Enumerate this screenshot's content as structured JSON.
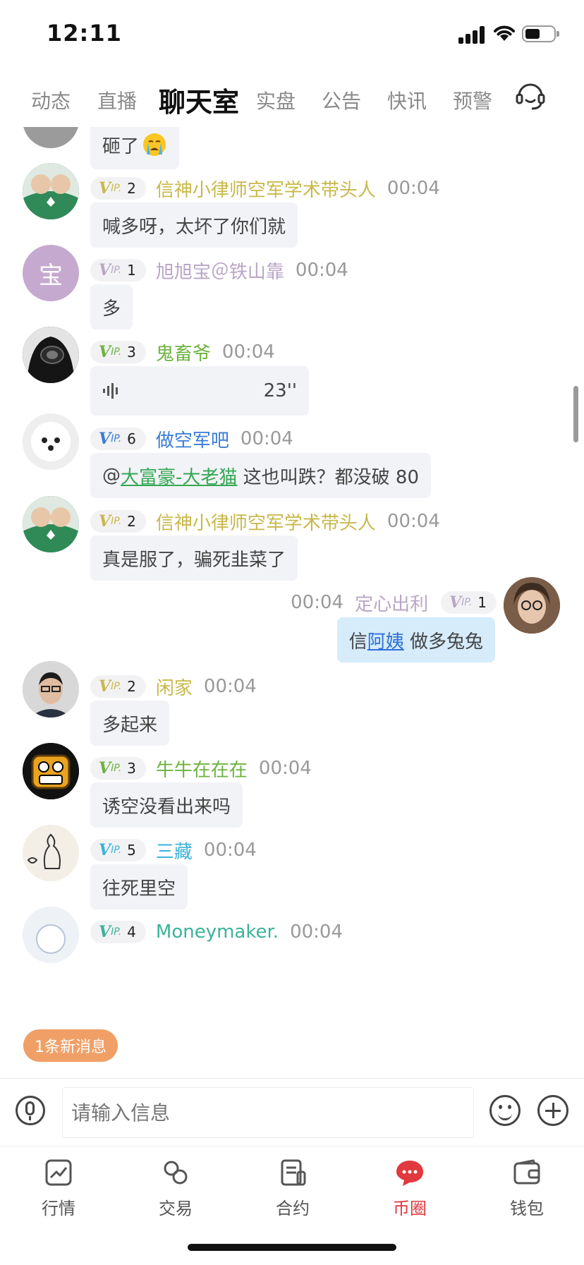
{
  "status_bar": {
    "time": "12:11"
  },
  "tabs": [
    {
      "label": "动态",
      "active": false
    },
    {
      "label": "直播",
      "active": false
    },
    {
      "label": "聊天室",
      "active": true
    },
    {
      "label": "实盘",
      "active": false
    },
    {
      "label": "公告",
      "active": false
    },
    {
      "label": "快讯",
      "active": false
    },
    {
      "label": "预警",
      "active": false
    }
  ],
  "messages": [
    {
      "text": "砸了"
    },
    {
      "vip": {
        "mark": "V",
        "sub": "IP.",
        "level": "2",
        "color": "#c8b84a"
      },
      "name": "信神小律师空军学术带头人",
      "name_color": "#c8b84a",
      "time": "00:04",
      "text": "喊多呀，太坏了你们就"
    },
    {
      "avatar_letter": "宝",
      "vip": {
        "mark": "V",
        "sub": "IP.",
        "level": "1",
        "color": "#b9a6c6"
      },
      "name": "旭旭宝＠铁山靠",
      "name_color": "#b9a6c6",
      "time": "00:04",
      "text": "多"
    },
    {
      "vip": {
        "mark": "V",
        "sub": "IP.",
        "level": "3",
        "color": "#6cb33f"
      },
      "name": "鬼畜爷",
      "name_color": "#6cb33f",
      "time": "00:04",
      "voice_duration": "23''"
    },
    {
      "vip": {
        "mark": "V",
        "sub": "IP.",
        "level": "6",
        "color": "#3a7bd5"
      },
      "name": "做空军吧",
      "name_color": "#3a7bd5",
      "time": "00:04",
      "mention_prefix": "@",
      "mention": "大富豪-大老猫",
      "text": " 这也叫跌？都没破 80"
    },
    {
      "vip": {
        "mark": "V",
        "sub": "IP.",
        "level": "2",
        "color": "#c8b84a"
      },
      "name": "信神小律师空军学术带头人",
      "name_color": "#c8b84a",
      "time": "00:04",
      "text": "真是服了，骗死韭菜了"
    },
    {
      "mine": true,
      "vip": {
        "mark": "V",
        "sub": "IP.",
        "level": "1",
        "color": "#b9a6c6"
      },
      "name": "定心出利",
      "name_color": "#b9a6c6",
      "time": "00:04",
      "text_pre": "信",
      "link": "阿姨",
      "text_post": " 做多兔兔"
    },
    {
      "vip": {
        "mark": "V",
        "sub": "IP.",
        "level": "2",
        "color": "#c8b84a"
      },
      "name": "闲家",
      "name_color": "#c8b84a",
      "time": "00:04",
      "text": "多起来"
    },
    {
      "vip": {
        "mark": "V",
        "sub": "IP.",
        "level": "3",
        "color": "#6cb33f"
      },
      "name": "牛牛在在在",
      "name_color": "#6cb33f",
      "time": "00:04",
      "text": "诱空没看出来吗"
    },
    {
      "vip": {
        "mark": "V",
        "sub": "IP.",
        "level": "5",
        "color": "#3bb3d8"
      },
      "name": "三藏",
      "name_color": "#3bb3d8",
      "time": "00:04",
      "text": "往死里空"
    },
    {
      "vip": {
        "mark": "V",
        "sub": "IP.",
        "level": "4",
        "color": "#3bb39a"
      },
      "name": "Moneymaker.",
      "name_color": "#3bb39a",
      "time": "00:04"
    }
  ],
  "new_message_badge": "1条新消息",
  "input": {
    "placeholder": "请输入信息"
  },
  "bottom_nav": [
    {
      "label": "行情",
      "icon": "chart-icon",
      "active": false
    },
    {
      "label": "交易",
      "icon": "exchange-icon",
      "active": false
    },
    {
      "label": "合约",
      "icon": "contract-icon",
      "active": false
    },
    {
      "label": "币圈",
      "icon": "chat-bubble-icon",
      "active": true
    },
    {
      "label": "钱包",
      "icon": "wallet-icon",
      "active": false
    }
  ],
  "colors": {
    "accent": "#e0393e",
    "new_message": "#f0a066",
    "my_bubble": "#d6ecfb"
  }
}
